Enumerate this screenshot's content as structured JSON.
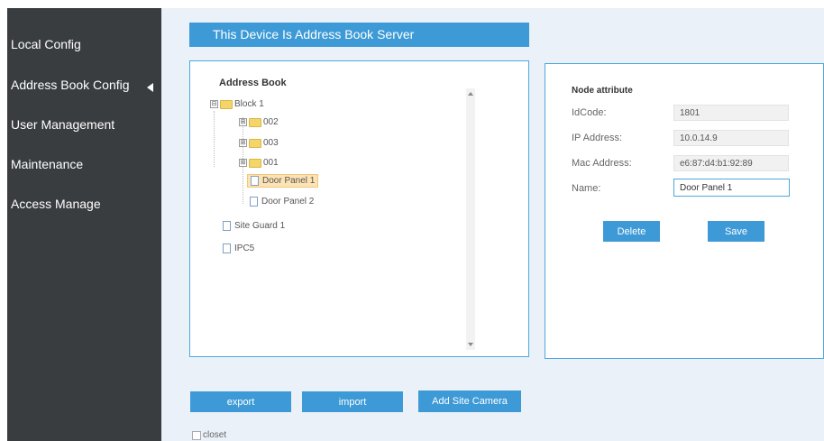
{
  "sidebar": {
    "items": [
      {
        "label": "Local Config"
      },
      {
        "label": "Address Book Config",
        "active": true
      },
      {
        "label": "User Management"
      },
      {
        "label": "Maintenance"
      },
      {
        "label": "Access Manage"
      }
    ]
  },
  "banner": {
    "text": "This Device Is Address Book Server"
  },
  "address_book": {
    "title": "Address Book",
    "tree": [
      {
        "label": "Block 1",
        "type": "folder",
        "expander": "⊟"
      },
      {
        "label": "002",
        "type": "folder",
        "expander": "⊞"
      },
      {
        "label": "003",
        "type": "folder",
        "expander": "⊞"
      },
      {
        "label": "001",
        "type": "folder",
        "expander": "⊞"
      },
      {
        "label": "Door Panel 1",
        "type": "doc",
        "selected": true
      },
      {
        "label": "Door Panel 2",
        "type": "doc"
      },
      {
        "label": "Site Guard 1",
        "type": "doc"
      },
      {
        "label": "IPC5",
        "type": "doc"
      }
    ]
  },
  "node_attribute": {
    "title": "Node attribute",
    "fields": [
      {
        "label": "IdCode:",
        "value": "1801"
      },
      {
        "label": "IP Address:",
        "value": "10.0.14.9"
      },
      {
        "label": "Mac Address:",
        "value": "e6:87:d4:b1:92:89"
      },
      {
        "label": "Name:",
        "value": "Door Panel 1"
      }
    ],
    "delete_label": "Delete",
    "save_label": "Save"
  },
  "actions": {
    "export_label": "export",
    "import_label": "import",
    "add_site_camera_label": "Add Site Camera"
  },
  "closet": {
    "label": "closet",
    "checked": false
  },
  "colors": {
    "sidebar_bg": "#3a3d40",
    "main_bg": "#eaf1f9",
    "accent": "#3d9ad6",
    "selected_node": "#fde3b4"
  }
}
